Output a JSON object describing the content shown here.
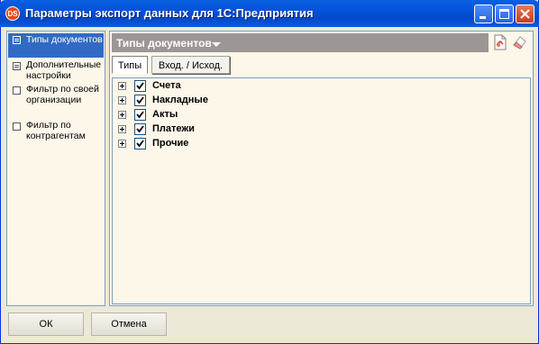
{
  "window": {
    "title": "Параметры экспорт данных для 1С:Предприятия",
    "app_icon_text": "DS",
    "colors": {
      "titlebar": "#0454dc",
      "close": "#c43f18",
      "selected": "#316ac5",
      "panel_bg": "#fdf7ea",
      "header_bar": "#9c9695"
    }
  },
  "sidebar": {
    "items": [
      {
        "label": "Типы документов",
        "selected": true,
        "icon": "list-icon"
      },
      {
        "label": "Дополнительные настройки",
        "selected": false,
        "icon": "list-icon"
      },
      {
        "label": "Фильтр по своей организации",
        "selected": false,
        "icon": "checkbox-icon"
      },
      {
        "label": "Фильтр по контрагентам",
        "selected": false,
        "icon": "checkbox-icon"
      }
    ]
  },
  "main": {
    "header_title": "Типы документов",
    "tabs": [
      {
        "label": "Типы",
        "active": true
      },
      {
        "label": "Вход. / Исход.",
        "active": false
      }
    ],
    "tree": [
      {
        "label": "Счета",
        "checked": true
      },
      {
        "label": "Накладные",
        "checked": true
      },
      {
        "label": "Акты",
        "checked": true
      },
      {
        "label": "Платежи",
        "checked": true
      },
      {
        "label": "Прочие",
        "checked": true
      }
    ]
  },
  "footer": {
    "ok_label": "ОК",
    "cancel_label": "Отмена"
  }
}
